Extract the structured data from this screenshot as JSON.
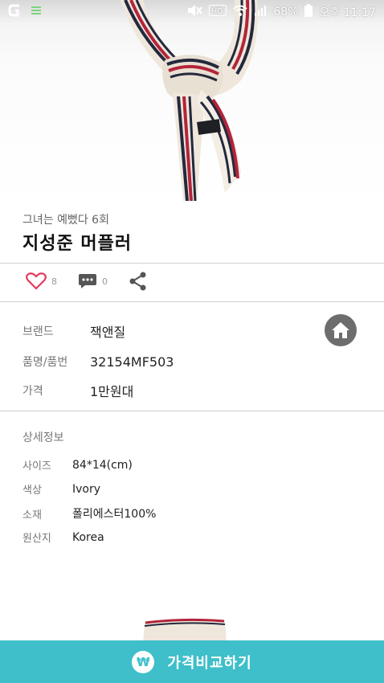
{
  "status_bar": {
    "battery_percent": "68%",
    "time": "오후 11:17",
    "icons": [
      "app-icon",
      "notification-icon",
      "mute-icon",
      "hd-icon",
      "wifi-icon",
      "signal-icon",
      "battery-icon"
    ]
  },
  "product": {
    "subtitle": "그녀는 예뻤다 6회",
    "title": "지성준 머플러"
  },
  "actions": {
    "likes": "8",
    "comments": "0",
    "like_color": "#e33b5d"
  },
  "info": {
    "brand_label": "브랜드",
    "brand_value": "잭앤질",
    "model_label": "품명/품번",
    "model_value": "32154MF503",
    "price_label": "가격",
    "price_value": "1만원대"
  },
  "details": {
    "heading": "상세정보",
    "rows": [
      {
        "label": "사이즈",
        "value": "84*14(cm)"
      },
      {
        "label": "색상",
        "value": "Ivory"
      },
      {
        "label": "소재",
        "value": "폴리에스터100%"
      },
      {
        "label": "원산지",
        "value": "Korea"
      }
    ]
  },
  "compare_bar": {
    "icon_symbol": "₩",
    "label": "가격비교하기",
    "color": "#3ebfca"
  }
}
